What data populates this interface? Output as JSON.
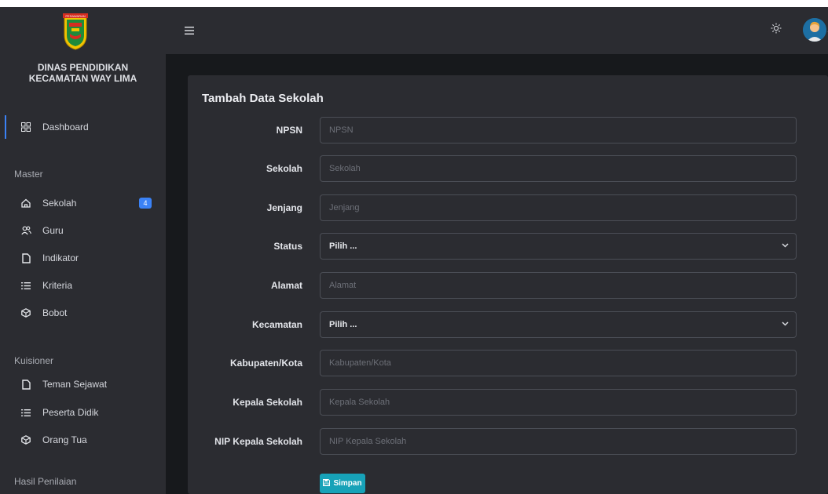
{
  "brand": {
    "name_line1": "DINAS PENDIDIKAN",
    "name_line2": "KECAMATAN WAY LIMA",
    "logo_text": "PESAWARAN"
  },
  "sidebar": {
    "dashboard": {
      "label": "Dashboard",
      "icon": "grid-icon"
    },
    "master_header": "Master",
    "master_items": [
      {
        "label": "Sekolah",
        "icon": "home-icon",
        "badge": "4"
      },
      {
        "label": "Guru",
        "icon": "users-icon"
      },
      {
        "label": "Indikator",
        "icon": "file-icon"
      },
      {
        "label": "Kriteria",
        "icon": "list-icon"
      },
      {
        "label": "Bobot",
        "icon": "box-icon"
      }
    ],
    "kuisioner_header": "Kuisioner",
    "kuisioner_items": [
      {
        "label": "Teman Sejawat",
        "icon": "file-icon"
      },
      {
        "label": "Peserta Didik",
        "icon": "list-icon"
      },
      {
        "label": "Orang Tua",
        "icon": "box-icon"
      }
    ],
    "hasil_header": "Hasil Penilaian"
  },
  "topbar": {
    "menu_icon": "hamburger-icon",
    "theme_icon": "sun-icon",
    "avatar_icon": "user-avatar-icon"
  },
  "form": {
    "title": "Tambah Data Sekolah",
    "fields": [
      {
        "label": "NPSN",
        "placeholder": "NPSN",
        "type": "input"
      },
      {
        "label": "Sekolah",
        "placeholder": "Sekolah",
        "type": "input"
      },
      {
        "label": "Jenjang",
        "placeholder": "Jenjang",
        "type": "input"
      },
      {
        "label": "Status",
        "value": "Pilih ...",
        "type": "select"
      },
      {
        "label": "Alamat",
        "placeholder": "Alamat",
        "type": "input"
      },
      {
        "label": "Kecamatan",
        "value": "Pilih ...",
        "type": "select"
      },
      {
        "label": "Kabupaten/Kota",
        "placeholder": "Kabupaten/Kota",
        "type": "input"
      },
      {
        "label": "Kepala Sekolah",
        "placeholder": "Kepala Sekolah",
        "type": "input"
      },
      {
        "label": "NIP Kepala Sekolah",
        "placeholder": "NIP Kepala Sekolah",
        "type": "input"
      }
    ],
    "save_label": "Simpan",
    "save_icon": "save-icon"
  },
  "colors": {
    "accent": "#3b82f6",
    "button": "#17a2b8",
    "panel": "#2b2c31",
    "background": "#17191c"
  }
}
